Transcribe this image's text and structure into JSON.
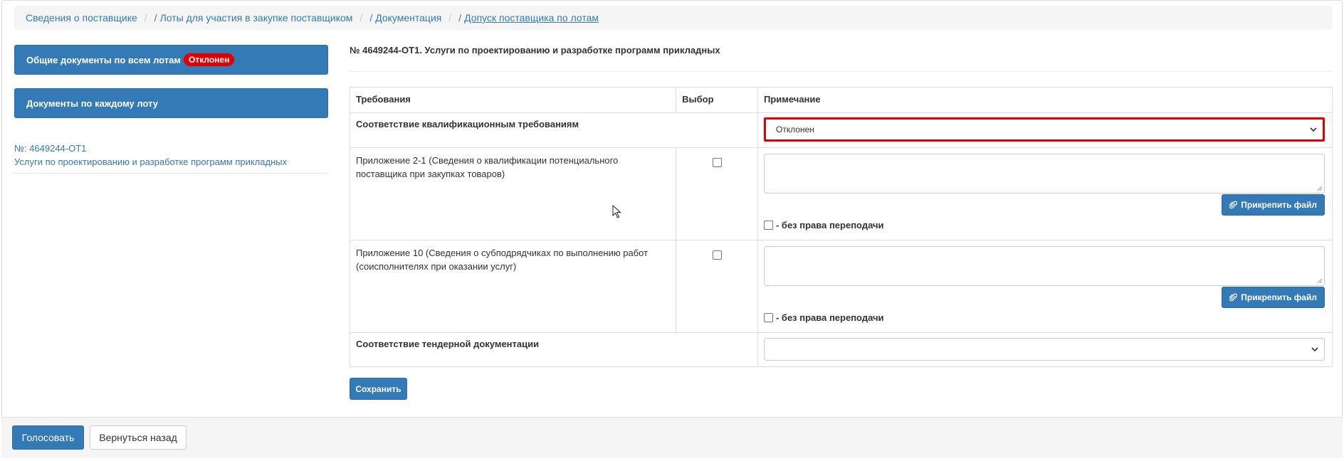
{
  "breadcrumb": {
    "items": [
      "Сведения о поставщике",
      "Лоты для участия в закупке поставщиком",
      "Документация",
      "Допуск поставщика по лотам"
    ],
    "separator": "/"
  },
  "sidebar": {
    "general_docs_label": "Общие документы по всем лотам",
    "general_docs_badge": "Отклонен",
    "per_lot_docs_label": "Документы по каждому лоту",
    "lot_number": "№: 4649244-ОТ1",
    "lot_name": "Услуги по проектированию и разработке программ прикладных"
  },
  "main": {
    "lot_title": "№ 4649244-ОТ1. Услуги по проектированию и разработке программ прикладных",
    "table": {
      "headers": [
        "Требования",
        "Выбор",
        "Примечание"
      ],
      "qualification": {
        "label": "Соответствие квалификационным требованиям",
        "select_value": "Отклонен"
      },
      "rows": [
        {
          "text": "Приложение 2-1 (Сведения о квалификации потенциального поставщика при закупках товаров)",
          "checked": false,
          "attach_label": "Прикрепить файл",
          "noresubmit_label": "- без права переподачи"
        },
        {
          "text": "Приложение 10 (Сведения о субподрядчиках по выполнению работ (соисполнителях при оказании услуг)",
          "checked": false,
          "attach_label": "Прикрепить файл",
          "noresubmit_label": "- без права переподачи"
        }
      ],
      "tender": {
        "label": "Соответствие тендерной документации",
        "select_value": ""
      }
    },
    "save_label": "Сохранить"
  },
  "footer": {
    "vote_label": "Голосовать",
    "back_label": "Вернуться назад"
  },
  "colors": {
    "primary": "#337ab7",
    "badge": "#e00000",
    "highlight_border": "#e00000"
  }
}
